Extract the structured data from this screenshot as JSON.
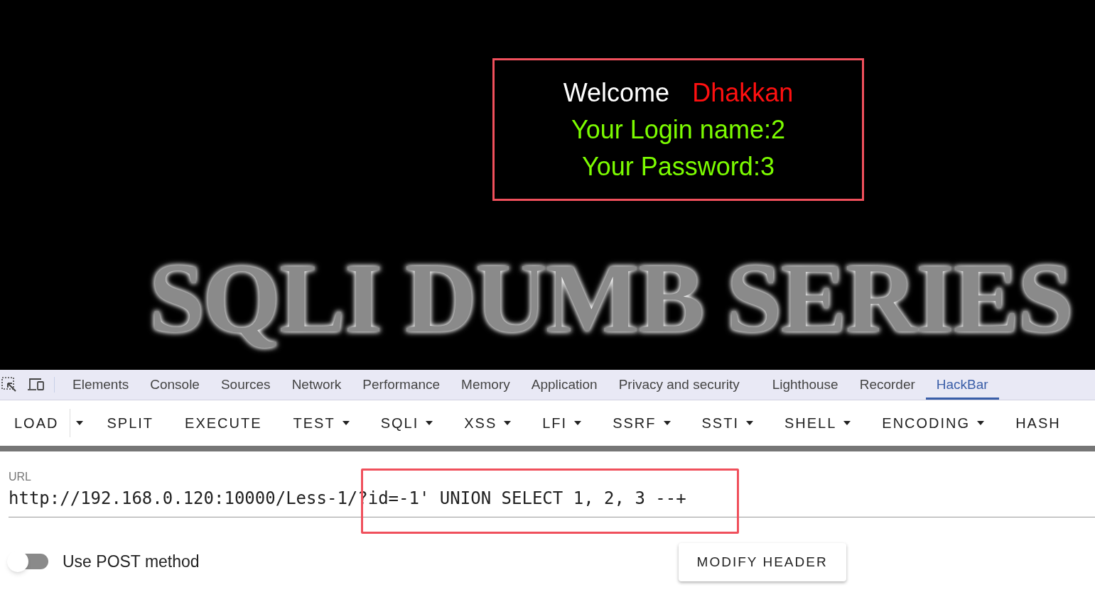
{
  "page": {
    "welcome": "Welcome",
    "user": "Dhakkan",
    "login_line": "Your Login name:2",
    "password_line": "Your Password:3",
    "logo": "SQLI DUMB SERIES"
  },
  "devtools_tabs": [
    {
      "label": "Elements",
      "selected": false
    },
    {
      "label": "Console",
      "selected": false
    },
    {
      "label": "Sources",
      "selected": false
    },
    {
      "label": "Network",
      "selected": false
    },
    {
      "label": "Performance",
      "selected": false
    },
    {
      "label": "Memory",
      "selected": false
    },
    {
      "label": "Application",
      "selected": false
    },
    {
      "label": "Privacy and security",
      "selected": false
    },
    {
      "label": "Lighthouse",
      "selected": false
    },
    {
      "label": "Recorder",
      "selected": false
    },
    {
      "label": "HackBar",
      "selected": true
    }
  ],
  "hackbar": {
    "toolbar": [
      {
        "label": "LOAD",
        "kind": "split"
      },
      {
        "label": "SPLIT",
        "kind": "plain"
      },
      {
        "label": "EXECUTE",
        "kind": "plain"
      },
      {
        "label": "TEST",
        "kind": "menu"
      },
      {
        "label": "SQLI",
        "kind": "menu"
      },
      {
        "label": "XSS",
        "kind": "menu"
      },
      {
        "label": "LFI",
        "kind": "menu"
      },
      {
        "label": "SSRF",
        "kind": "menu"
      },
      {
        "label": "SSTI",
        "kind": "menu"
      },
      {
        "label": "SHELL",
        "kind": "menu"
      },
      {
        "label": "ENCODING",
        "kind": "menu"
      },
      {
        "label": "HASH",
        "kind": "plain"
      }
    ],
    "url_label": "URL",
    "url": "http://192.168.0.120:10000/Less-1/?id=-1' UNION SELECT 1, 2, 3 --+",
    "post_method": {
      "label": "Use POST method",
      "on": false
    },
    "modify_header": "MODIFY HEADER"
  }
}
